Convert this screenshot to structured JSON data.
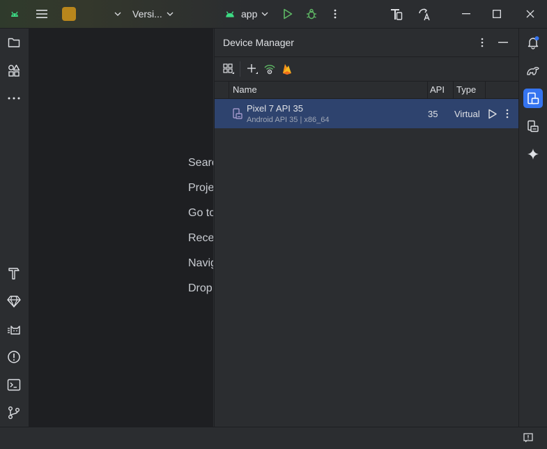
{
  "titlebar": {
    "project_menu_label": "Versi...",
    "run_config": "app",
    "icons": [
      "android-icon",
      "hamburger-menu-icon",
      "project-badge",
      "chevron-down-icon",
      "run-icon",
      "debug-icon",
      "more-vert-icon",
      "device-mirror-icon",
      "translate-icon",
      "minimize-icon",
      "maximize-icon",
      "close-icon"
    ],
    "colors": {
      "project_badge": "#b8861c",
      "run_green": "#5fb865",
      "android_green": "#3ddc84"
    }
  },
  "left_toolbar": {
    "top_icons": [
      "project-folder-icon",
      "resource-manager-icon",
      "more-icon"
    ],
    "bottom_icons": [
      "build-hammer-icon",
      "gem-icon",
      "logcat-icon",
      "problems-icon",
      "terminal-icon",
      "git-icon"
    ]
  },
  "editor_hints": [
    "Searc",
    "Proje",
    "Go to",
    "Rece",
    "Navig",
    "Drop"
  ],
  "device_manager": {
    "title": "Device Manager",
    "toolbar_icons": [
      "device-group-icon",
      "add-device-icon",
      "wifi-pairing-icon",
      "firebase-icon"
    ],
    "columns": {
      "name": "Name",
      "api": "API",
      "type": "Type"
    },
    "devices": [
      {
        "name": "Pixel 7 API 35",
        "subtitle": "Android API 35 | x86_64",
        "api": "35",
        "type": "Virtual"
      }
    ],
    "colors": {
      "selected_row": "#2e436e"
    }
  },
  "right_toolbar": {
    "icons": [
      "notifications-icon",
      "gradle-icon",
      "device-manager-icon",
      "running-devices-icon",
      "gemini-icon"
    ],
    "active": "device-manager-icon",
    "colors": {
      "active": "#3574f0",
      "notification_dot": "#3574f0"
    }
  },
  "statusbar": {
    "icons": [
      "status-notification-icon"
    ]
  }
}
